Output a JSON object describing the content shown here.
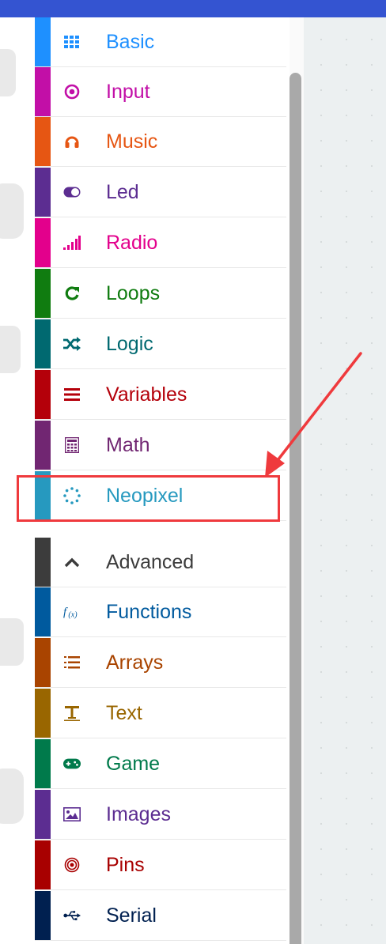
{
  "toolbox": {
    "categories": [
      {
        "label": "Basic",
        "color": "#1e90ff",
        "icon": "grid-icon"
      },
      {
        "label": "Input",
        "color": "#c20fa7",
        "icon": "target-icon"
      },
      {
        "label": "Music",
        "color": "#e65613",
        "icon": "headphones-icon"
      },
      {
        "label": "Led",
        "color": "#5c2d91",
        "icon": "toggle-icon"
      },
      {
        "label": "Radio",
        "color": "#e3008c",
        "icon": "signal-bars-icon"
      },
      {
        "label": "Loops",
        "color": "#107c10",
        "icon": "refresh-icon"
      },
      {
        "label": "Logic",
        "color": "#006970",
        "icon": "shuffle-icon"
      },
      {
        "label": "Variables",
        "color": "#b4000a",
        "icon": "list-lines-icon"
      },
      {
        "label": "Math",
        "color": "#712672",
        "icon": "calculator-icon"
      },
      {
        "label": "Neopixel",
        "color": "#2699bf",
        "icon": "dotted-circle-icon"
      }
    ],
    "advanced": {
      "label": "Advanced",
      "color": "#3c3c3c",
      "icon": "chevron-up-icon"
    },
    "advanced_categories": [
      {
        "label": "Functions",
        "color": "#005a9e",
        "icon": "function-icon"
      },
      {
        "label": "Arrays",
        "color": "#a94400",
        "icon": "ordered-list-icon"
      },
      {
        "label": "Text",
        "color": "#996600",
        "icon": "text-icon"
      },
      {
        "label": "Game",
        "color": "#007a4b",
        "icon": "gamepad-icon"
      },
      {
        "label": "Images",
        "color": "#5c2d91",
        "icon": "image-icon"
      },
      {
        "label": "Pins",
        "color": "#a80000",
        "icon": "target-rings-icon"
      },
      {
        "label": "Serial",
        "color": "#002050",
        "icon": "usb-icon"
      }
    ]
  },
  "colors": {
    "topbar": "#3454d1",
    "highlight": "#ef3a3d",
    "workspace": "#ecf0f1"
  }
}
